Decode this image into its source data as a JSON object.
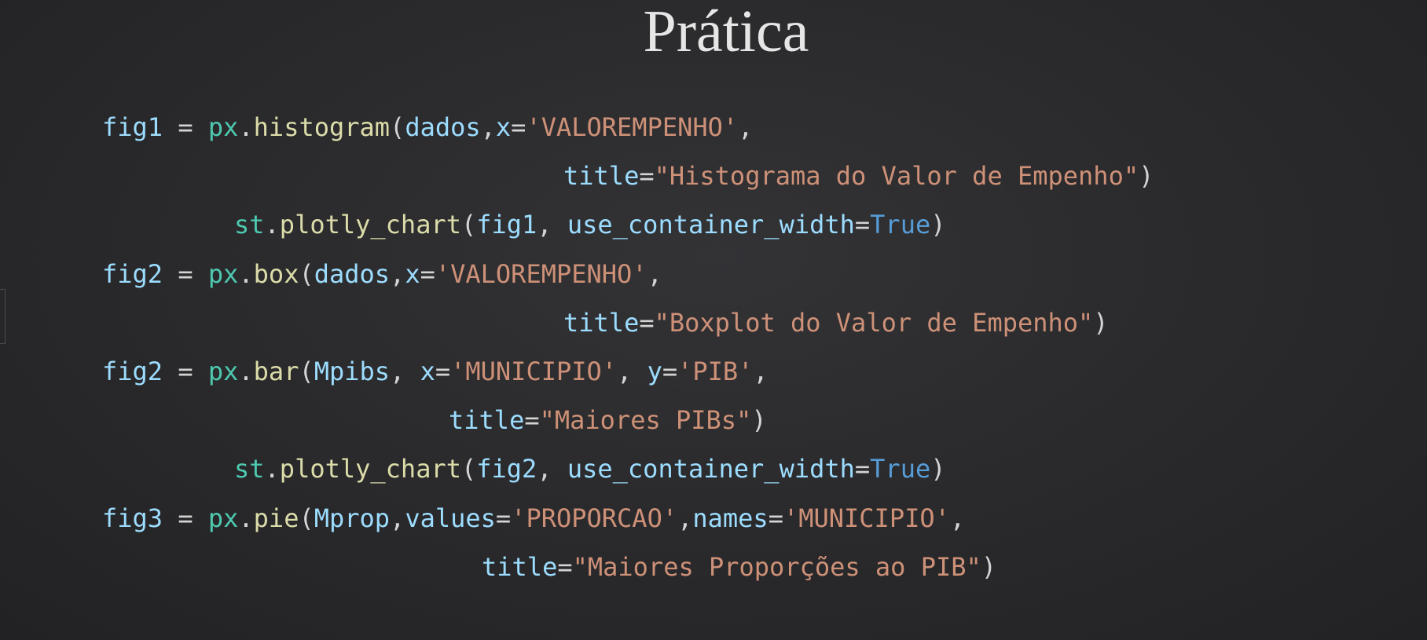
{
  "slide": {
    "title": "Prática"
  },
  "code": {
    "lines": [
      [
        {
          "t": "fig1",
          "c": "v"
        },
        {
          "t": " = ",
          "c": "p"
        },
        {
          "t": "px",
          "c": "m"
        },
        {
          "t": ".",
          "c": "p"
        },
        {
          "t": "histogram",
          "c": "f"
        },
        {
          "t": "(",
          "c": "p"
        },
        {
          "t": "dados",
          "c": "v"
        },
        {
          "t": ",",
          "c": "p"
        },
        {
          "t": "x",
          "c": "v"
        },
        {
          "t": "=",
          "c": "p"
        },
        {
          "t": "'VALOREMPENHO'",
          "c": "s"
        },
        {
          "t": ",",
          "c": "p"
        }
      ],
      [
        {
          "t": "title",
          "c": "v"
        },
        {
          "t": "=",
          "c": "p"
        },
        {
          "t": "\"Histograma do Valor de Empenho\"",
          "c": "s"
        },
        {
          "t": ")",
          "c": "p"
        }
      ],
      [
        {
          "t": "st",
          "c": "m"
        },
        {
          "t": ".",
          "c": "p"
        },
        {
          "t": "plotly_chart",
          "c": "f"
        },
        {
          "t": "(",
          "c": "p"
        },
        {
          "t": "fig1",
          "c": "v"
        },
        {
          "t": ", ",
          "c": "p"
        },
        {
          "t": "use_container_width",
          "c": "v"
        },
        {
          "t": "=",
          "c": "p"
        },
        {
          "t": "True",
          "c": "k"
        },
        {
          "t": ")",
          "c": "p"
        }
      ],
      [
        {
          "t": "fig2",
          "c": "v"
        },
        {
          "t": " = ",
          "c": "p"
        },
        {
          "t": "px",
          "c": "m"
        },
        {
          "t": ".",
          "c": "p"
        },
        {
          "t": "box",
          "c": "f"
        },
        {
          "t": "(",
          "c": "p"
        },
        {
          "t": "dados",
          "c": "v"
        },
        {
          "t": ",",
          "c": "p"
        },
        {
          "t": "x",
          "c": "v"
        },
        {
          "t": "=",
          "c": "p"
        },
        {
          "t": "'VALOREMPENHO'",
          "c": "s"
        },
        {
          "t": ",",
          "c": "p"
        }
      ],
      [
        {
          "t": "title",
          "c": "v"
        },
        {
          "t": "=",
          "c": "p"
        },
        {
          "t": "\"Boxplot do Valor de Empenho\"",
          "c": "s"
        },
        {
          "t": ")",
          "c": "p"
        }
      ],
      [
        {
          "t": "fig2",
          "c": "v"
        },
        {
          "t": " = ",
          "c": "p"
        },
        {
          "t": "px",
          "c": "m"
        },
        {
          "t": ".",
          "c": "p"
        },
        {
          "t": "bar",
          "c": "f"
        },
        {
          "t": "(",
          "c": "p"
        },
        {
          "t": "Mpibs",
          "c": "v"
        },
        {
          "t": ", ",
          "c": "p"
        },
        {
          "t": "x",
          "c": "v"
        },
        {
          "t": "=",
          "c": "p"
        },
        {
          "t": "'MUNICIPIO'",
          "c": "s"
        },
        {
          "t": ", ",
          "c": "p"
        },
        {
          "t": "y",
          "c": "v"
        },
        {
          "t": "=",
          "c": "p"
        },
        {
          "t": "'PIB'",
          "c": "s"
        },
        {
          "t": ",",
          "c": "p"
        }
      ],
      [
        {
          "t": "title",
          "c": "v"
        },
        {
          "t": "=",
          "c": "p"
        },
        {
          "t": "\"Maiores PIBs\"",
          "c": "s"
        },
        {
          "t": ")",
          "c": "p"
        }
      ],
      [
        {
          "t": "st",
          "c": "m"
        },
        {
          "t": ".",
          "c": "p"
        },
        {
          "t": "plotly_chart",
          "c": "f"
        },
        {
          "t": "(",
          "c": "p"
        },
        {
          "t": "fig2",
          "c": "v"
        },
        {
          "t": ", ",
          "c": "p"
        },
        {
          "t": "use_container_width",
          "c": "v"
        },
        {
          "t": "=",
          "c": "p"
        },
        {
          "t": "True",
          "c": "k"
        },
        {
          "t": ")",
          "c": "p"
        }
      ],
      [
        {
          "t": "fig3",
          "c": "v"
        },
        {
          "t": " = ",
          "c": "p"
        },
        {
          "t": "px",
          "c": "m"
        },
        {
          "t": ".",
          "c": "p"
        },
        {
          "t": "pie",
          "c": "f"
        },
        {
          "t": "(",
          "c": "p"
        },
        {
          "t": "Mprop",
          "c": "v"
        },
        {
          "t": ",",
          "c": "p"
        },
        {
          "t": "values",
          "c": "v"
        },
        {
          "t": "=",
          "c": "p"
        },
        {
          "t": "'PROPORCAO'",
          "c": "s"
        },
        {
          "t": ",",
          "c": "p"
        },
        {
          "t": "names",
          "c": "v"
        },
        {
          "t": "=",
          "c": "p"
        },
        {
          "t": "'MUNICIPIO'",
          "c": "s"
        },
        {
          "t": ",",
          "c": "p"
        }
      ],
      [
        {
          "t": "title",
          "c": "v"
        },
        {
          "t": "=",
          "c": "p"
        },
        {
          "t": "\"Maiores Proporções ao PIB\"",
          "c": "s"
        },
        {
          "t": ")",
          "c": "p"
        }
      ]
    ]
  }
}
